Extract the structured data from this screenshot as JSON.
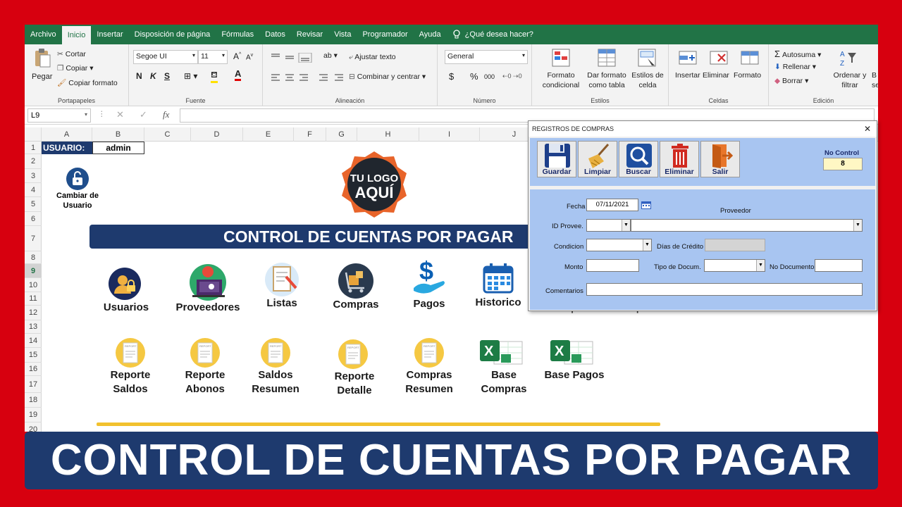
{
  "ribbon_tabs": [
    "Archivo",
    "Inicio",
    "Insertar",
    "Disposición de página",
    "Fórmulas",
    "Datos",
    "Revisar",
    "Vista",
    "Programador",
    "Ayuda"
  ],
  "tell_me": "¿Qué desea hacer?",
  "clipboard": {
    "paste": "Pegar",
    "cut": "Cortar",
    "copy": "Copiar",
    "format_painter": "Copiar formato",
    "label": "Portapapeles"
  },
  "font": {
    "name": "Segoe UI",
    "size": "11",
    "bold": "N",
    "italic": "K",
    "underline": "S",
    "label": "Fuente"
  },
  "alignment": {
    "wrap": "Ajustar texto",
    "merge": "Combinar y centrar",
    "label": "Alineación"
  },
  "number": {
    "format": "General",
    "currency": "$",
    "percent": "%",
    "thousands": "000",
    "label": "Número"
  },
  "styles": {
    "conditional": "Formato condicional",
    "table": "Dar formato como tabla",
    "cell": "Estilos de celda",
    "label": "Estilos"
  },
  "cells": {
    "insert": "Insertar",
    "delete": "Eliminar",
    "format": "Formato",
    "label": "Celdas"
  },
  "editing": {
    "autosum": "Autosuma",
    "fill": "Rellenar",
    "clear": "Borrar",
    "sort": "Ordenar y filtrar",
    "select_partial": "B sele",
    "label": "Edición"
  },
  "name_box": "L9",
  "fx": "fx",
  "columns": [
    "A",
    "B",
    "C",
    "D",
    "E",
    "F",
    "G",
    "H",
    "I",
    "J"
  ],
  "rows": [
    "1",
    "2",
    "3",
    "4",
    "5",
    "6",
    "7",
    "8",
    "9",
    "10",
    "11",
    "12",
    "13",
    "14",
    "15",
    "16",
    "17",
    "18",
    "19",
    "20"
  ],
  "sheet": {
    "user_label": "USUARIO:",
    "user_value": "admin",
    "change_user": "Cambiar de Usuario",
    "logo_line1": "TU LOGO",
    "logo_line2": "AQUÍ",
    "title": "CONTROL DE CUENTAS POR PAGAR",
    "menu1": [
      "Usuarios",
      "Proveedores",
      "Listas",
      "Compras",
      "Pagos",
      "Historico"
    ],
    "menu2": [
      "Reporte Saldos",
      "Reporte Abonos",
      "Saldos Resumen",
      "Reporte Detalle",
      "Compras Resumen",
      "Base Compras",
      "Base Pagos"
    ],
    "report_tag": "REPORT",
    "hidden_partial": [
      "Reporte",
      "p",
      "Base"
    ]
  },
  "dialog": {
    "title": "REGISTROS DE COMPRAS",
    "close": "✕",
    "buttons": [
      "Guardar",
      "Limpiar",
      "Buscar",
      "Eliminar",
      "Salir"
    ],
    "no_control_label": "No Control",
    "no_control_value": "8",
    "fecha_label": "Fecha",
    "fecha_value": "07/11/2021",
    "proveedor_label": "Proveedor",
    "id_prov_label": "ID Provee.",
    "condicion_label": "Condicion",
    "dias_label": "Días de Crédito",
    "monto_label": "Monto",
    "tipo_label": "Tipo de Docum.",
    "nodoc_label": "No Documento",
    "comentarios_label": "Comentarios"
  },
  "banner": "CONTROL DE CUENTAS POR PAGAR",
  "colors": {
    "frame": "#d7000f",
    "excel_green": "#217346",
    "navy": "#1e3a6e",
    "dialog_body": "#a8c5f1",
    "gold": "#f2c12e"
  }
}
